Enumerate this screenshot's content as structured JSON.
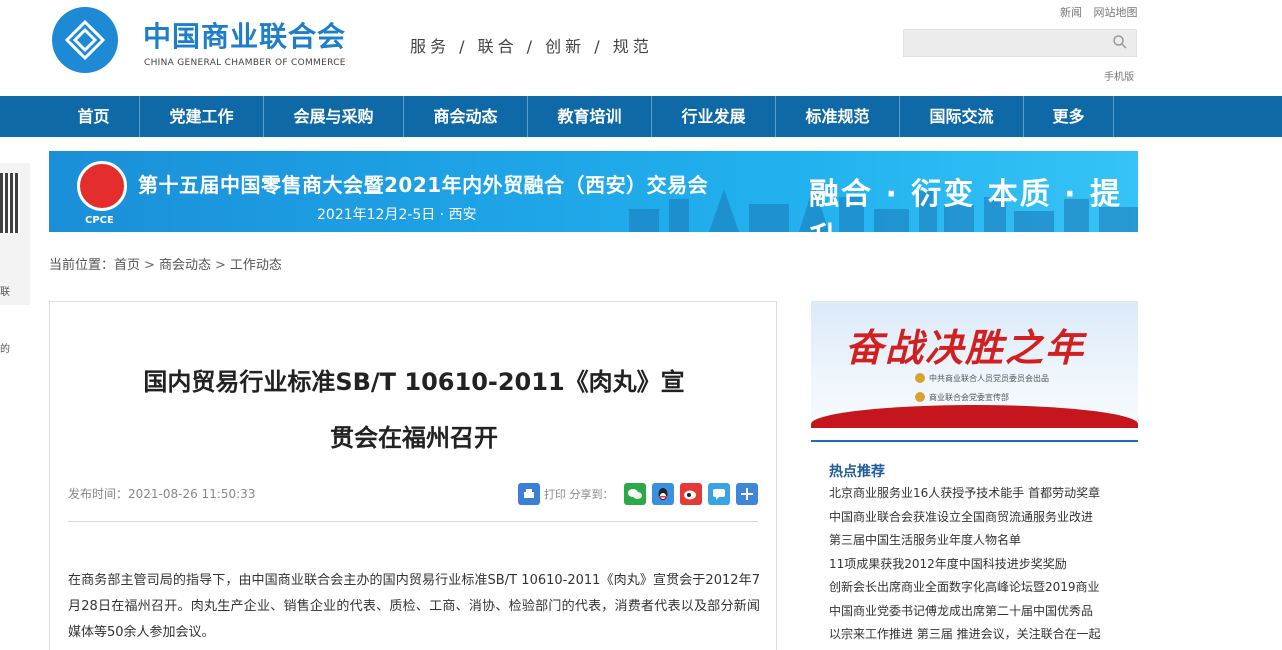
{
  "header": {
    "org_name": "中国商业联合会",
    "org_name_en": "CHINA GENERAL CHAMBER OF COMMERCE",
    "slogan": "服务 / 联合 / 创新 / 规范",
    "top_links": [
      "新闻",
      "网站地图"
    ],
    "search_placeholder": "",
    "mobile_link": "手机版"
  },
  "nav": {
    "items": [
      "首页",
      "党建工作",
      "会展与采购",
      "商会动态",
      "教育培训",
      "行业发展",
      "标准规范",
      "国际交流",
      "更多"
    ]
  },
  "left_float": {
    "text1": "联",
    "text2": "的"
  },
  "banner": {
    "title": "第十五届中国零售商大会暨2021年内外贸融合（西安）交易会",
    "date": "2021年12月2-5日 · 西安",
    "slogan": "融合 · 衍变  本质 · 提升",
    "logo_text": "CPCE"
  },
  "breadcrumb": {
    "label": "当前位置：",
    "items": [
      "首页",
      "商会动态",
      "工作动态"
    ]
  },
  "article": {
    "title_line1": "国内贸易行业标准SB/T 10610-2011《肉丸》宣",
    "title_line2": "贯会在福州召开",
    "meta": "发布时间：2021-08-26 11:50:33",
    "share_label": "打印 分享到：",
    "body": "在商务部主管司局的指导下，由中国商业联合会主办的国内贸易行业标准SB/T 10610-2011《肉丸》宣贯会于2012年7月28日在福州召开。肉丸生产企业、销售企业的代表、质检、工商、消协、检验部门的代表，消费者代表以及部分新闻媒体等50余人参加会议。"
  },
  "sidebar": {
    "banner_title": "奋战决胜之年",
    "banner_org1": "中共商业联合人员党员委员会出品",
    "banner_org2": "商业联合会党委宣传部",
    "hot_title": "热点推荐",
    "hot_items": [
      "北京商业服务业16人获授予技术能手 首都劳动奖章",
      "中国商业联合会获准设立全国商贸流通服务业改进",
      "第三届中国生活服务业年度人物名单",
      "11项成果获我2012年度中国科技进步奖奖励",
      "创新会长出席商业全面数字化高峰论坛暨2019商业",
      "中国商业党委书记傅龙成出席第二十届中国优秀品",
      "以宗来工作推进 第三届 推进会议，关注联合在一起"
    ]
  },
  "colors": {
    "brand_blue": "#1e7fc8",
    "nav_bg": "#0f69a6",
    "accent_red": "#d21f1f"
  }
}
